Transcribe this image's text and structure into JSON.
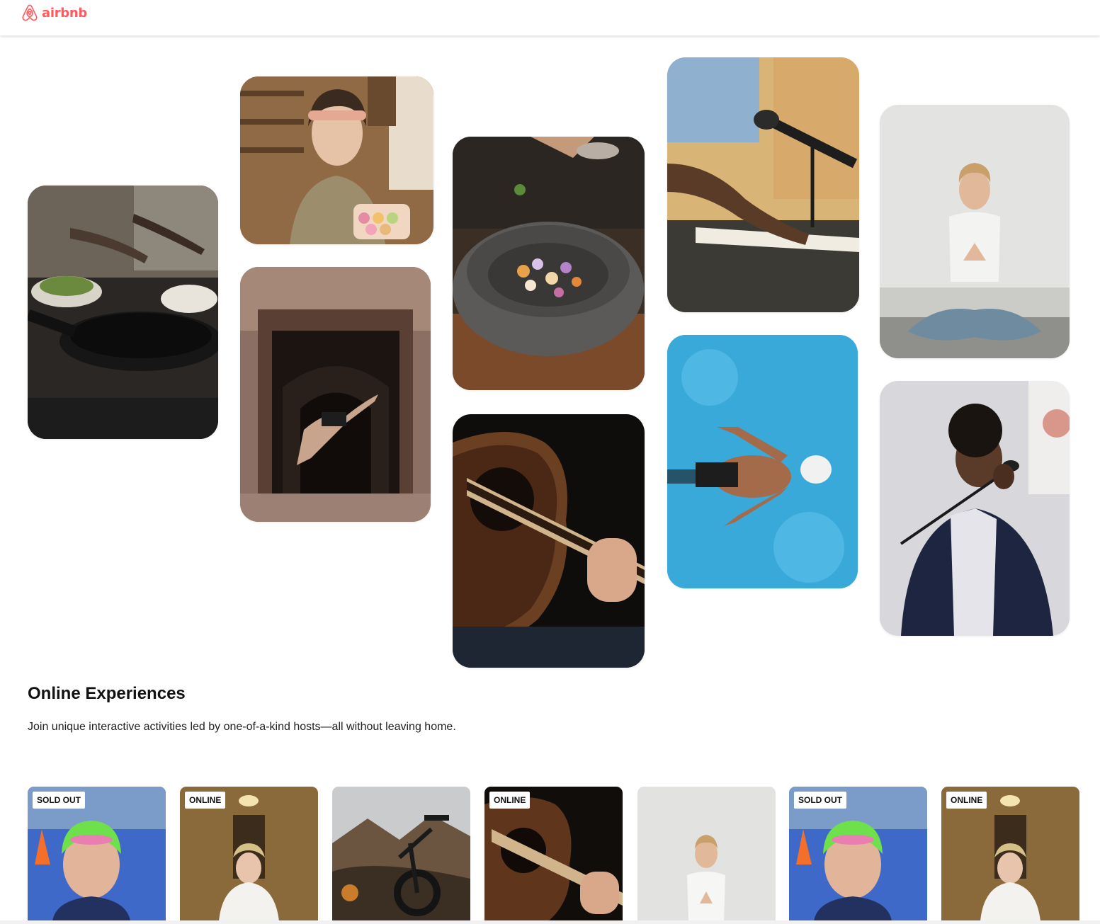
{
  "navbar": {
    "logo_text": "airbnb",
    "logo_icon": "airbnb-belo-icon",
    "brand_color": "#ff5a5f"
  },
  "hero": {
    "photos": [
      {
        "name": "photo-cooking-pan",
        "subject": "hands cooking with pans"
      },
      {
        "name": "photo-woman-macarons",
        "subject": "woman holding macarons"
      },
      {
        "name": "photo-dancer-doorway",
        "subject": "dancer leaping in doorway"
      },
      {
        "name": "photo-salting-bowl",
        "subject": "salting a stone bowl of vegetables"
      },
      {
        "name": "photo-guitar",
        "subject": "acoustic guitar"
      },
      {
        "name": "photo-keyboard-mic",
        "subject": "keyboard with microphone"
      },
      {
        "name": "photo-swimmer",
        "subject": "swimmer in pool"
      },
      {
        "name": "photo-yoga",
        "subject": "woman meditating"
      },
      {
        "name": "photo-singer",
        "subject": "singer at microphone"
      }
    ]
  },
  "online_experiences": {
    "title": "Online Experiences",
    "subtitle": "Join unique interactive activities led by one-of-a-kind hosts—all without leaving home.",
    "cards": [
      {
        "badge": "SOLD OUT",
        "subject": "swimmer in cap"
      },
      {
        "badge": "ONLINE",
        "subject": "bride"
      },
      {
        "badge": "",
        "subject": "mountain bike"
      },
      {
        "badge": "ONLINE",
        "subject": "guitar"
      },
      {
        "badge": "",
        "subject": "yoga"
      },
      {
        "badge": "SOLD OUT",
        "subject": "swimmer in cap"
      },
      {
        "badge": "ONLINE",
        "subject": "bride"
      }
    ]
  }
}
